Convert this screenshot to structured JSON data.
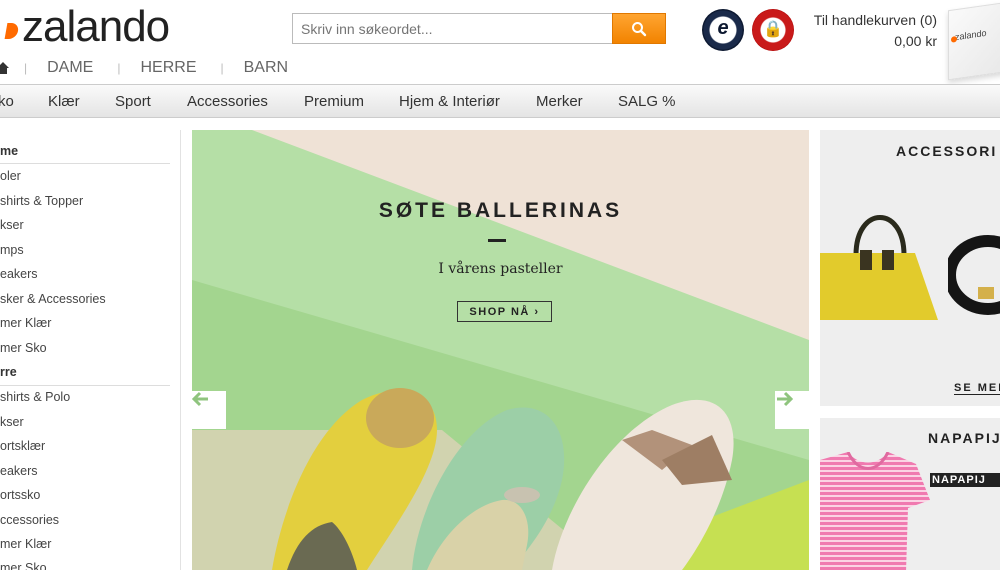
{
  "header": {
    "logo": "zalando",
    "search_placeholder": "Skriv inn søkeordet...",
    "trusted_badge": "e",
    "trygg_badge": "🔒",
    "cart_label": "Til handlekurven (0)",
    "cart_amount": "0,00 kr",
    "cart_box_label": "zalando"
  },
  "gender_nav": [
    "DAME",
    "HERRE",
    "BARN"
  ],
  "main_nav": [
    "ko",
    "Klær",
    "Sport",
    "Accessories",
    "Premium",
    "Hjem & Interiør",
    "Merker",
    "SALG %"
  ],
  "sidebar": {
    "dame_head": "me",
    "dame_items": [
      "oler",
      "shirts & Topper",
      "kser",
      "mps",
      "eakers",
      "sker & Accessories",
      "mer Klær",
      "mer Sko"
    ],
    "herre_head": "rre",
    "herre_items": [
      "shirts & Polo",
      "kser",
      "ortsklær",
      "eakers",
      "ortssko",
      "ccessories",
      "mer Klær",
      "mer Sko"
    ]
  },
  "hero": {
    "title": "SØTE BALLERINAS",
    "subtitle": "I vårens pasteller",
    "button": "SHOP NÅ ›"
  },
  "panels": {
    "accessories_title": "ACCESSORI",
    "accessories_link": "SE MER",
    "napapijri_title": "NAPAPIJ",
    "napapijri_logo": "NAPAPIJ"
  },
  "colors": {
    "accent": "#f28300",
    "nav_bg": "#e4e4e4",
    "hero_green": "#a9d99c"
  }
}
